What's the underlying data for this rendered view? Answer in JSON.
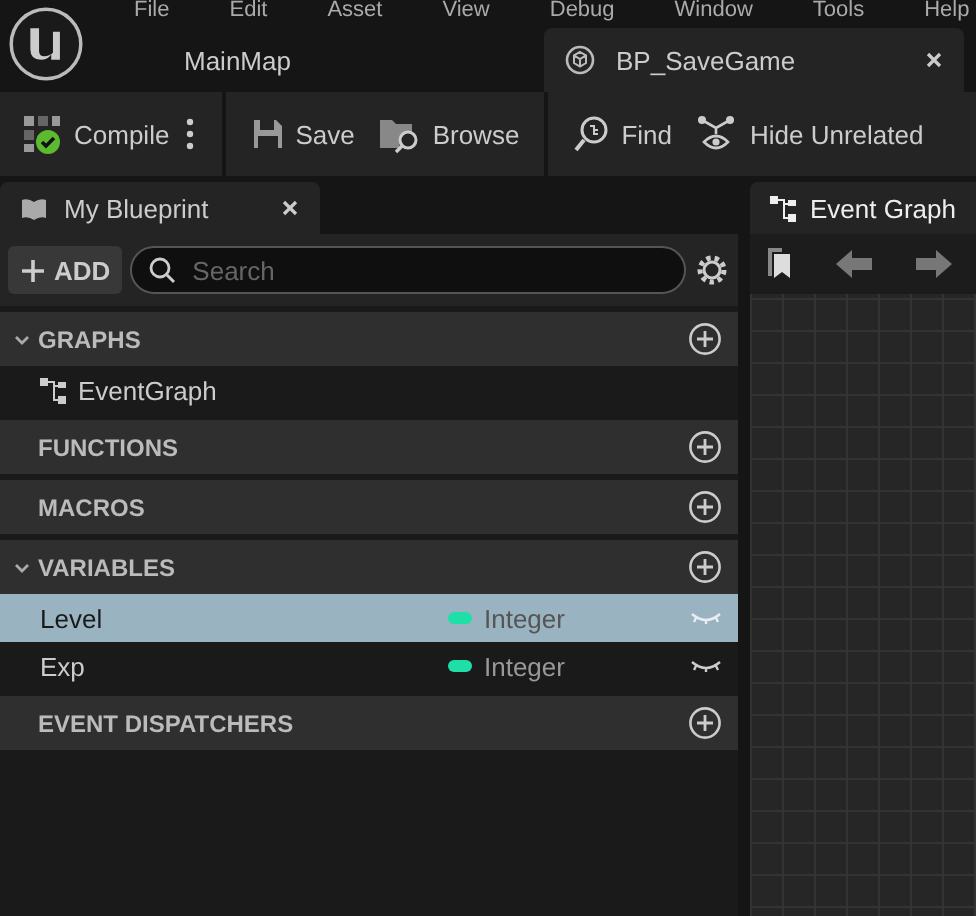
{
  "menu": [
    "File",
    "Edit",
    "Asset",
    "View",
    "Debug",
    "Window",
    "Tools",
    "Help"
  ],
  "doc_tabs": [
    {
      "label": "MainMap",
      "selected": false
    },
    {
      "label": "BP_SaveGame",
      "selected": true
    }
  ],
  "toolbar": [
    {
      "kind": "compile",
      "label": "Compile"
    },
    {
      "kind": "save",
      "label": "Save"
    },
    {
      "kind": "browse",
      "label": "Browse"
    },
    {
      "kind": "find",
      "label": "Find"
    },
    {
      "kind": "hide",
      "label": "Hide Unrelated"
    }
  ],
  "panel_tab": {
    "label": "My Blueprint"
  },
  "add_button": "ADD",
  "search": {
    "placeholder": "Search"
  },
  "sections": [
    {
      "title": "GRAPHS",
      "expanded": true,
      "items": [
        {
          "label": "EventGraph",
          "selected": false
        }
      ]
    },
    {
      "title": "FUNCTIONS"
    },
    {
      "title": "MACROS"
    },
    {
      "title": "VARIABLES",
      "expanded": true,
      "variables": [
        {
          "name": "Level",
          "type": "Integer",
          "color": "#1fdfa8",
          "selected": true
        },
        {
          "name": "Exp",
          "type": "Integer",
          "color": "#1fdfa8",
          "selected": false
        }
      ]
    },
    {
      "title": "EVENT DISPATCHERS"
    }
  ],
  "graph_tab": {
    "label": "Event Graph"
  }
}
